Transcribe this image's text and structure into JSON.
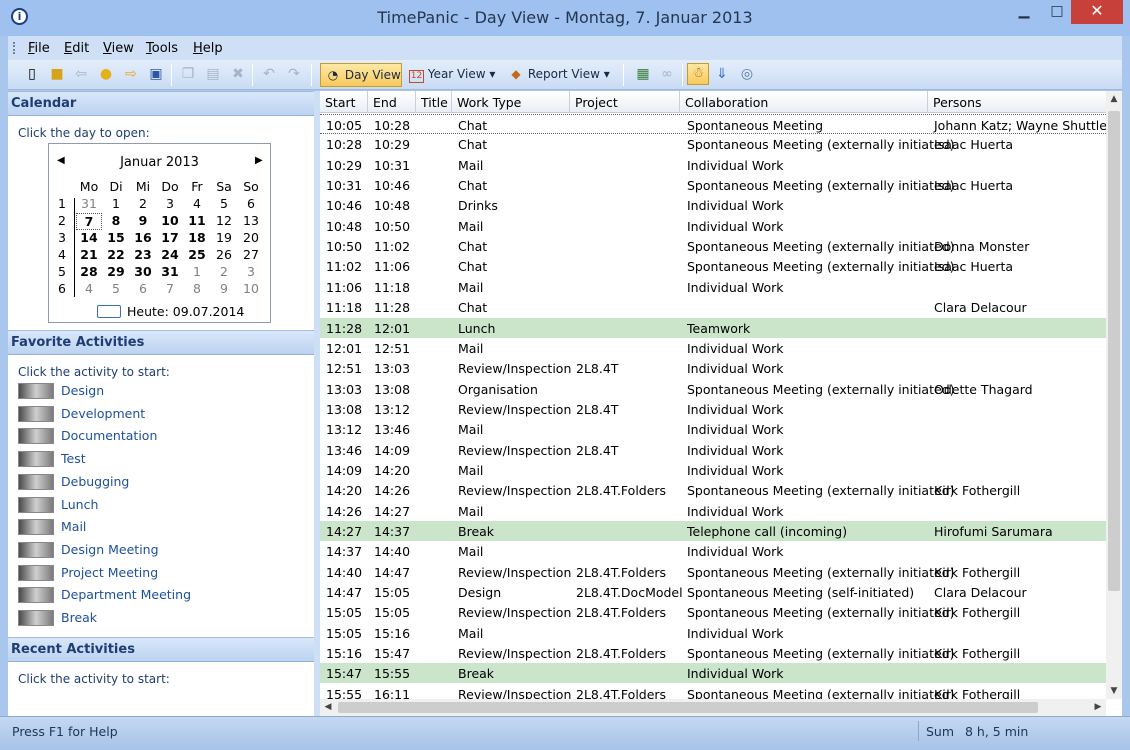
{
  "window": {
    "title": "TimePanic - Day View - Montag, 7. Januar 2013",
    "app_icon_glyph": "i",
    "minimize_glyph": "▁",
    "maximize_glyph": "□",
    "close_glyph": "✕"
  },
  "menu": [
    "File",
    "Edit",
    "View",
    "Tools",
    "Help"
  ],
  "toolbar": {
    "day_view": "Day View",
    "year_view": "Year View",
    "report_view": "Report View",
    "year_view_icon_text": "12",
    "dropdown_glyph": "▾",
    "icons": {
      "new": "new-file-icon",
      "open": "open-folder-icon",
      "back": "back-arrow-icon",
      "record": "record-dot-icon",
      "forward": "forward-arrow-icon",
      "save": "save-disk-icon",
      "copy": "copy-icon",
      "paste": "paste-icon",
      "delete": "delete-icon",
      "undo": "undo-icon",
      "redo": "redo-icon",
      "add_table": "add-table-icon",
      "link": "link-icon",
      "activity": "activity-icon",
      "import": "import-icon",
      "sync": "sync-icon"
    }
  },
  "calendar": {
    "header": "Calendar",
    "hint": "Click the day to open:",
    "month": "Januar 2013",
    "prev": "◀",
    "next": "▶",
    "weekdays": [
      "Mo",
      "Di",
      "Mi",
      "Do",
      "Fr",
      "Sa",
      "So"
    ],
    "weeks": [
      {
        "wk": "1",
        "days": [
          "31",
          "1",
          "2",
          "3",
          "4",
          "5",
          "6"
        ]
      },
      {
        "wk": "2",
        "days": [
          "7",
          "8",
          "9",
          "10",
          "11",
          "12",
          "13"
        ]
      },
      {
        "wk": "3",
        "days": [
          "14",
          "15",
          "16",
          "17",
          "18",
          "19",
          "20"
        ]
      },
      {
        "wk": "4",
        "days": [
          "21",
          "22",
          "23",
          "24",
          "25",
          "26",
          "27"
        ]
      },
      {
        "wk": "5",
        "days": [
          "28",
          "29",
          "30",
          "31",
          "1",
          "2",
          "3"
        ]
      },
      {
        "wk": "6",
        "days": [
          "4",
          "5",
          "6",
          "7",
          "8",
          "9",
          "10"
        ]
      }
    ],
    "today": "Heute: 09.07.2014"
  },
  "favorites": {
    "header": "Favorite Activities",
    "hint": "Click the activity to start:",
    "items": [
      "Design",
      "Development",
      "Documentation",
      "Test",
      "Debugging",
      "Lunch",
      "Mail",
      "Design Meeting",
      "Project Meeting",
      "Department Meeting",
      "Break"
    ]
  },
  "recent": {
    "header": "Recent Activities",
    "hint": "Click the activity to start:"
  },
  "grid": {
    "columns": [
      "Start",
      "End",
      "Title",
      "Work Type",
      "Project",
      "Collaboration",
      "Persons"
    ],
    "rows": [
      {
        "start": "10:05",
        "end": "10:28",
        "title": "",
        "work": "Chat",
        "project": "",
        "collab": "Spontaneous Meeting",
        "persons": "Johann Katz; Wayne Shuttlewo"
      },
      {
        "start": "10:28",
        "end": "10:29",
        "title": "",
        "work": "Chat",
        "project": "",
        "collab": "Spontaneous Meeting (externally initiated)",
        "persons": "Isaac Huerta"
      },
      {
        "start": "10:29",
        "end": "10:31",
        "title": "",
        "work": "Mail",
        "project": "",
        "collab": "Individual Work",
        "persons": ""
      },
      {
        "start": "10:31",
        "end": "10:46",
        "title": "",
        "work": "Chat",
        "project": "",
        "collab": "Spontaneous Meeting (externally initiated)",
        "persons": "Isaac Huerta"
      },
      {
        "start": "10:46",
        "end": "10:48",
        "title": "",
        "work": "Drinks",
        "project": "",
        "collab": "Individual Work",
        "persons": ""
      },
      {
        "start": "10:48",
        "end": "10:50",
        "title": "",
        "work": "Mail",
        "project": "",
        "collab": "Individual Work",
        "persons": ""
      },
      {
        "start": "10:50",
        "end": "11:02",
        "title": "",
        "work": "Chat",
        "project": "",
        "collab": "Spontaneous Meeting (externally initiated)",
        "persons": "Donna Monster"
      },
      {
        "start": "11:02",
        "end": "11:06",
        "title": "",
        "work": "Chat",
        "project": "",
        "collab": "Spontaneous Meeting (externally initiated)",
        "persons": "Isaac Huerta"
      },
      {
        "start": "11:06",
        "end": "11:18",
        "title": "",
        "work": "Mail",
        "project": "",
        "collab": "Individual Work",
        "persons": ""
      },
      {
        "start": "11:18",
        "end": "11:28",
        "title": "",
        "work": "Chat",
        "project": "",
        "collab": "",
        "persons": "Clara Delacour"
      },
      {
        "start": "11:28",
        "end": "12:01",
        "title": "",
        "work": "Lunch",
        "project": "",
        "collab": "Teamwork",
        "persons": ""
      },
      {
        "start": "12:01",
        "end": "12:51",
        "title": "",
        "work": "Mail",
        "project": "",
        "collab": "Individual Work",
        "persons": ""
      },
      {
        "start": "12:51",
        "end": "13:03",
        "title": "",
        "work": "Review/Inspection",
        "project": "2L8.4T",
        "collab": "Individual Work",
        "persons": ""
      },
      {
        "start": "13:03",
        "end": "13:08",
        "title": "",
        "work": "Organisation",
        "project": "",
        "collab": "Spontaneous Meeting (externally initiated)",
        "persons": "Odette Thagard"
      },
      {
        "start": "13:08",
        "end": "13:12",
        "title": "",
        "work": "Review/Inspection",
        "project": "2L8.4T",
        "collab": "Individual Work",
        "persons": ""
      },
      {
        "start": "13:12",
        "end": "13:46",
        "title": "",
        "work": "Mail",
        "project": "",
        "collab": "Individual Work",
        "persons": ""
      },
      {
        "start": "13:46",
        "end": "14:09",
        "title": "",
        "work": "Review/Inspection",
        "project": "2L8.4T",
        "collab": "Individual Work",
        "persons": ""
      },
      {
        "start": "14:09",
        "end": "14:20",
        "title": "",
        "work": "Mail",
        "project": "",
        "collab": "Individual Work",
        "persons": ""
      },
      {
        "start": "14:20",
        "end": "14:26",
        "title": "",
        "work": "Review/Inspection",
        "project": "2L8.4T.Folders",
        "collab": "Spontaneous Meeting (externally initiated)",
        "persons": "Kirk Fothergill"
      },
      {
        "start": "14:26",
        "end": "14:27",
        "title": "",
        "work": "Mail",
        "project": "",
        "collab": "Individual Work",
        "persons": ""
      },
      {
        "start": "14:27",
        "end": "14:37",
        "title": "",
        "work": "Break",
        "project": "",
        "collab": "Telephone call (incoming)",
        "persons": "Hirofumi Sarumara"
      },
      {
        "start": "14:37",
        "end": "14:40",
        "title": "",
        "work": "Mail",
        "project": "",
        "collab": "Individual Work",
        "persons": ""
      },
      {
        "start": "14:40",
        "end": "14:47",
        "title": "",
        "work": "Review/Inspection",
        "project": "2L8.4T.Folders",
        "collab": "Spontaneous Meeting (externally initiated)",
        "persons": "Kirk Fothergill"
      },
      {
        "start": "14:47",
        "end": "15:05",
        "title": "",
        "work": "Design",
        "project": "2L8.4T.DocModel",
        "collab": "Spontaneous Meeting (self-initiated)",
        "persons": "Clara Delacour"
      },
      {
        "start": "15:05",
        "end": "15:05",
        "title": "",
        "work": "Review/Inspection",
        "project": "2L8.4T.Folders",
        "collab": "Spontaneous Meeting (externally initiated)",
        "persons": "Kirk Fothergill"
      },
      {
        "start": "15:05",
        "end": "15:16",
        "title": "",
        "work": "Mail",
        "project": "",
        "collab": "Individual Work",
        "persons": ""
      },
      {
        "start": "15:16",
        "end": "15:47",
        "title": "",
        "work": "Review/Inspection",
        "project": "2L8.4T.Folders",
        "collab": "Spontaneous Meeting (externally initiated)",
        "persons": "Kirk Fothergill"
      },
      {
        "start": "15:47",
        "end": "15:55",
        "title": "",
        "work": "Break",
        "project": "",
        "collab": "Individual Work",
        "persons": ""
      },
      {
        "start": "15:55",
        "end": "16:11",
        "title": "",
        "work": "Review/Inspection",
        "project": "2L8.4T.Folders",
        "collab": "Spontaneous Meeting (externally initiated)",
        "persons": "Kirk Fothergill"
      }
    ],
    "highlight_color": "#cbe5cb"
  },
  "status": {
    "help": "Press F1 for Help",
    "sum_label": "Sum",
    "sum_value": "8 h, 5 min"
  }
}
